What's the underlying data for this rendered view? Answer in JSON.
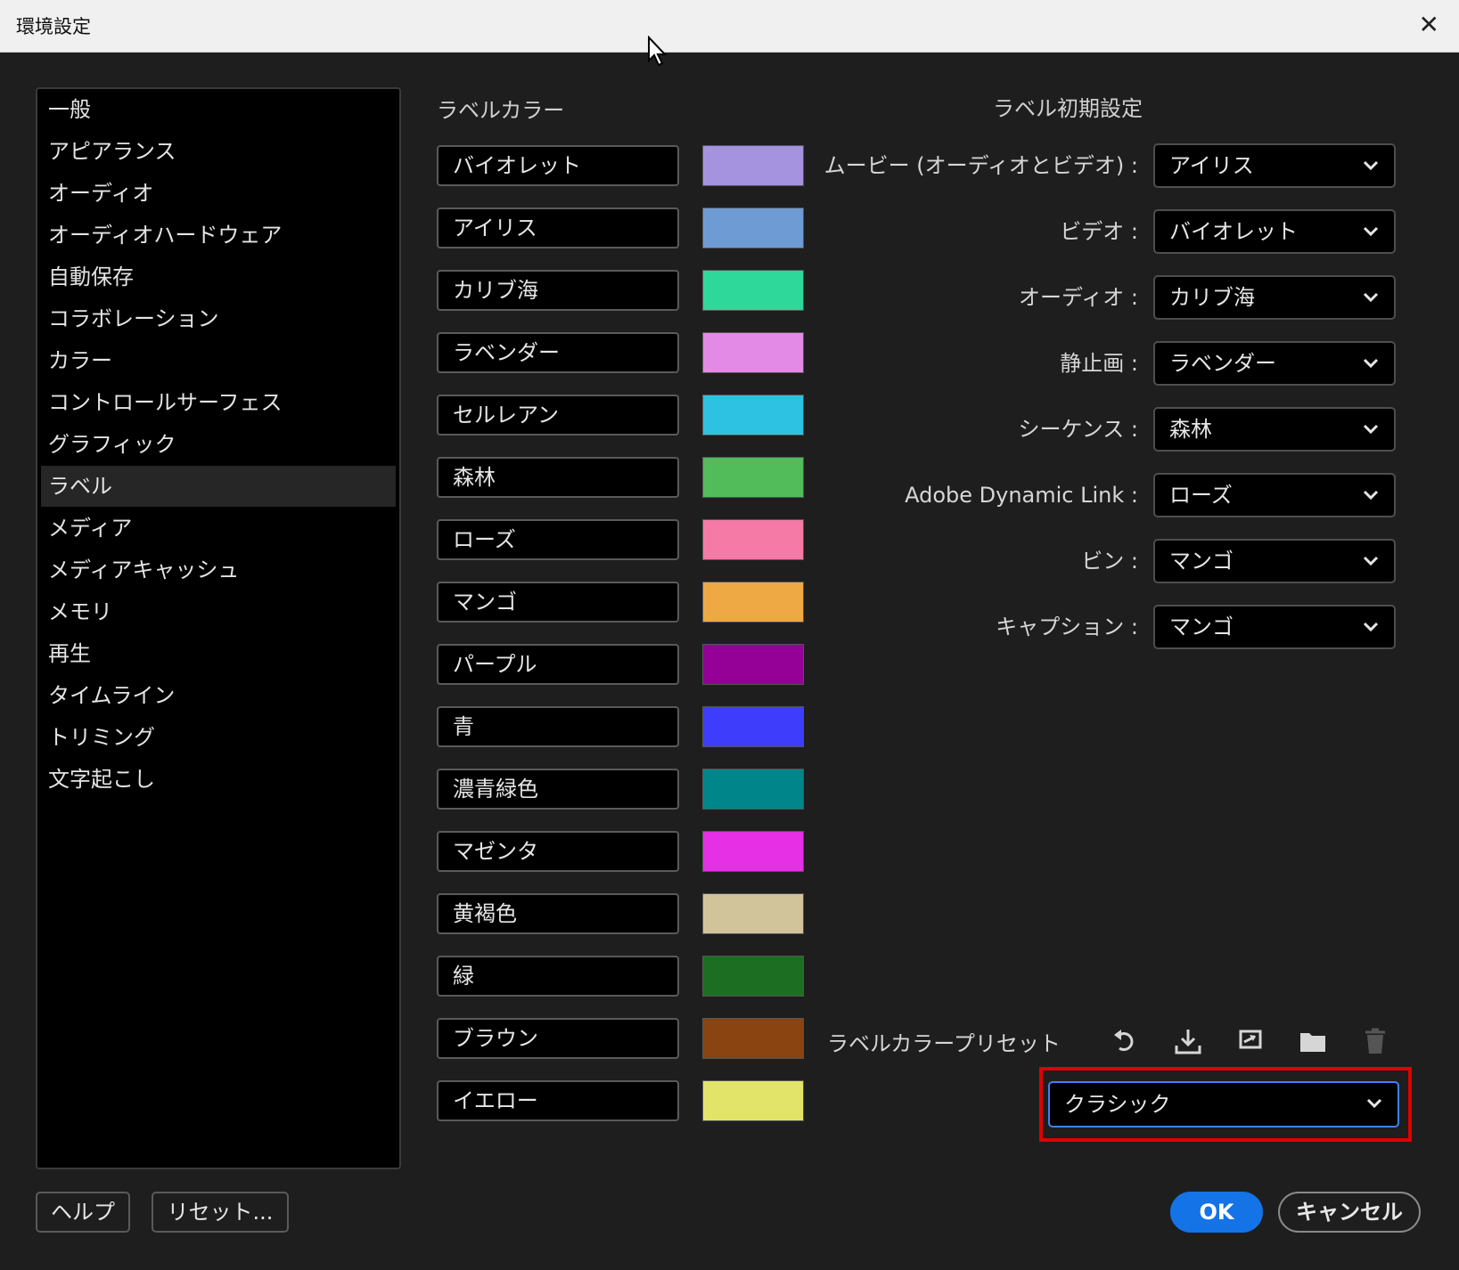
{
  "window": {
    "title": "環境設定"
  },
  "sidebar": {
    "items": [
      {
        "label": "一般"
      },
      {
        "label": "アピアランス"
      },
      {
        "label": "オーディオ"
      },
      {
        "label": "オーディオハードウェア"
      },
      {
        "label": "自動保存"
      },
      {
        "label": "コラボレーション"
      },
      {
        "label": "カラー"
      },
      {
        "label": "コントロールサーフェス"
      },
      {
        "label": "グラフィック"
      },
      {
        "label": "ラベル"
      },
      {
        "label": "メディア"
      },
      {
        "label": "メディアキャッシュ"
      },
      {
        "label": "メモリ"
      },
      {
        "label": "再生"
      },
      {
        "label": "タイムライン"
      },
      {
        "label": "トリミング"
      },
      {
        "label": "文字起こし"
      }
    ],
    "selected": "ラベル"
  },
  "label_colors": {
    "title": "ラベルカラー",
    "items": [
      {
        "name": "バイオレット",
        "color": "#a593e0"
      },
      {
        "name": "アイリス",
        "color": "#6f9bd4"
      },
      {
        "name": "カリブ海",
        "color": "#2ed89b"
      },
      {
        "name": "ラベンダー",
        "color": "#e38ae6"
      },
      {
        "name": "セルレアン",
        "color": "#2ec2e2"
      },
      {
        "name": "森林",
        "color": "#52bb5a"
      },
      {
        "name": "ローズ",
        "color": "#f57aa5"
      },
      {
        "name": "マンゴ",
        "color": "#eea844"
      },
      {
        "name": "パープル",
        "color": "#950097"
      },
      {
        "name": "青",
        "color": "#3d3dfb"
      },
      {
        "name": "濃青緑色",
        "color": "#00868a"
      },
      {
        "name": "マゼンタ",
        "color": "#e530e5"
      },
      {
        "name": "黄褐色",
        "color": "#d1c49b"
      },
      {
        "name": "緑",
        "color": "#1c6f22"
      },
      {
        "name": "ブラウン",
        "color": "#8a4412"
      },
      {
        "name": "イエロー",
        "color": "#e2e46a"
      }
    ]
  },
  "label_defaults": {
    "title": "ラベル初期設定",
    "rows": [
      {
        "label": "ムービー (オーディオとビデオ) :",
        "value": "アイリス"
      },
      {
        "label": "ビデオ :",
        "value": "バイオレット"
      },
      {
        "label": "オーディオ :",
        "value": "カリブ海"
      },
      {
        "label": "静止画 :",
        "value": "ラベンダー"
      },
      {
        "label": "シーケンス :",
        "value": "森林"
      },
      {
        "label": "Adobe Dynamic Link :",
        "value": "ローズ"
      },
      {
        "label": "ビン :",
        "value": "マンゴ"
      },
      {
        "label": "キャプション :",
        "value": "マンゴ"
      }
    ]
  },
  "preset": {
    "label": "ラベルカラープリセット",
    "value": "クラシック",
    "icons": [
      "undo-icon",
      "import-icon",
      "export-icon",
      "folder-icon",
      "trash-icon"
    ]
  },
  "footer": {
    "help": "ヘルプ",
    "reset": "リセット...",
    "ok": "OK",
    "cancel": "キャンセル"
  },
  "colors": {
    "accent": "#1473e6",
    "highlight": "#e00000"
  }
}
